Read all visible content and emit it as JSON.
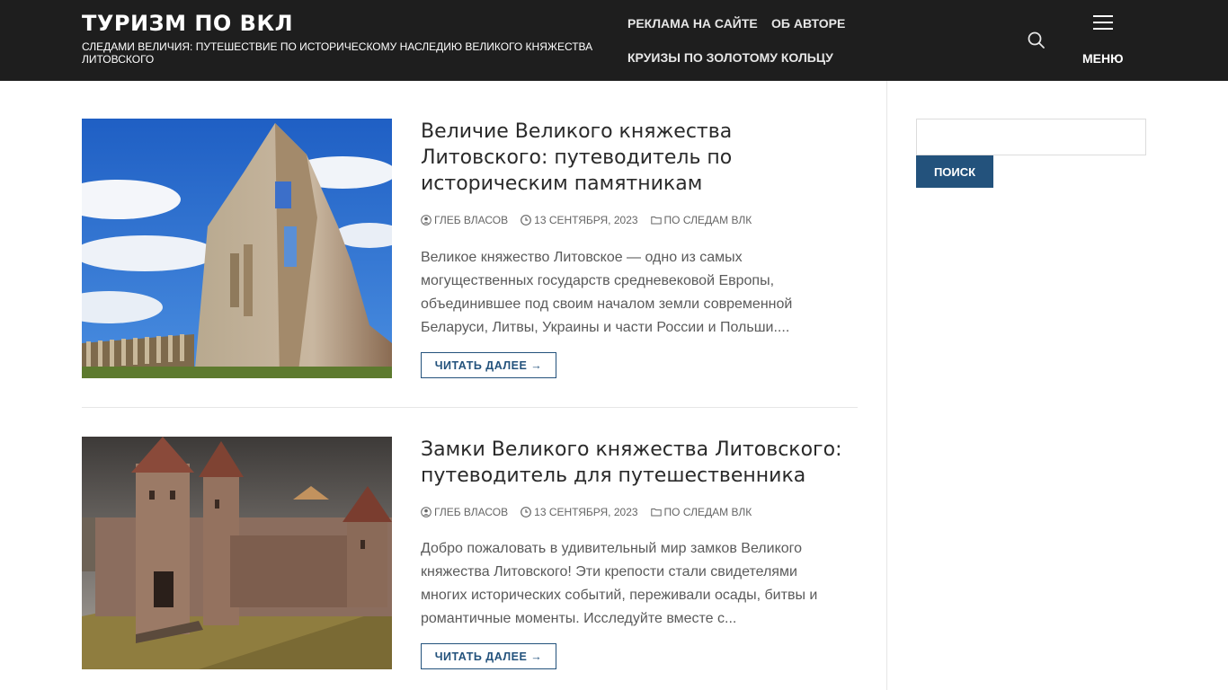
{
  "header": {
    "site_title": "ТУРИЗМ ПО ВКЛ",
    "site_description": "СЛЕДАМИ ВЕЛИЧИЯ: ПУТЕШЕСТВИЕ ПО ИСТОРИЧЕСКОМУ НАСЛЕДИЮ ВЕЛИКОГО КНЯЖЕСТВА ЛИТОВСКОГО",
    "nav": [
      {
        "label": "РЕКЛАМА НА САЙТЕ"
      },
      {
        "label": "ОБ АВТОРЕ"
      },
      {
        "label": "КРУИЗЫ ПО ЗОЛОТОМУ КОЛЬЦУ"
      }
    ],
    "search_icon": "search-icon",
    "menu_icon": "hamburger-icon",
    "menu_label": "МЕНЮ"
  },
  "posts": [
    {
      "title": "Величие Великого княжества Литовского: путеводитель по историческим памятникам",
      "author": "ГЛЕБ ВЛАСОВ",
      "date": "13 СЕНТЯБРЯ, 2023",
      "category": "ПО СЛЕДАМ ВЛК",
      "excerpt": "Великое княжество Литовское — одно из самых могущественных государств средневековой Европы, объединившее под своим началом земли современной Беларуси, Литвы, Украины и части России и Польши....",
      "read_more": "ЧИТАТЬ ДАЛЕЕ →",
      "image": "palace-ruins-photo"
    },
    {
      "title": "Замки Великого княжества Литовского: путеводитель для путешественника",
      "author": "ГЛЕБ ВЛАСОВ",
      "date": "13 СЕНТЯБРЯ, 2023",
      "category": "ПО СЛЕДАМ ВЛК",
      "excerpt": "Добро пожаловать в удивительный мир замков Великого княжества Литовского! Эти крепости стали свидетелями многих исторических событий, переживали осады, битвы и романтичные моменты. Исследуйте вместе с...",
      "read_more": "ЧИТАТЬ ДАЛЕЕ →",
      "image": "castle-render-photo"
    }
  ],
  "sidebar": {
    "search_value": "",
    "search_button": "ПОИСК"
  },
  "colors": {
    "header_bg": "#1e1e1e",
    "accent": "#23527c"
  }
}
